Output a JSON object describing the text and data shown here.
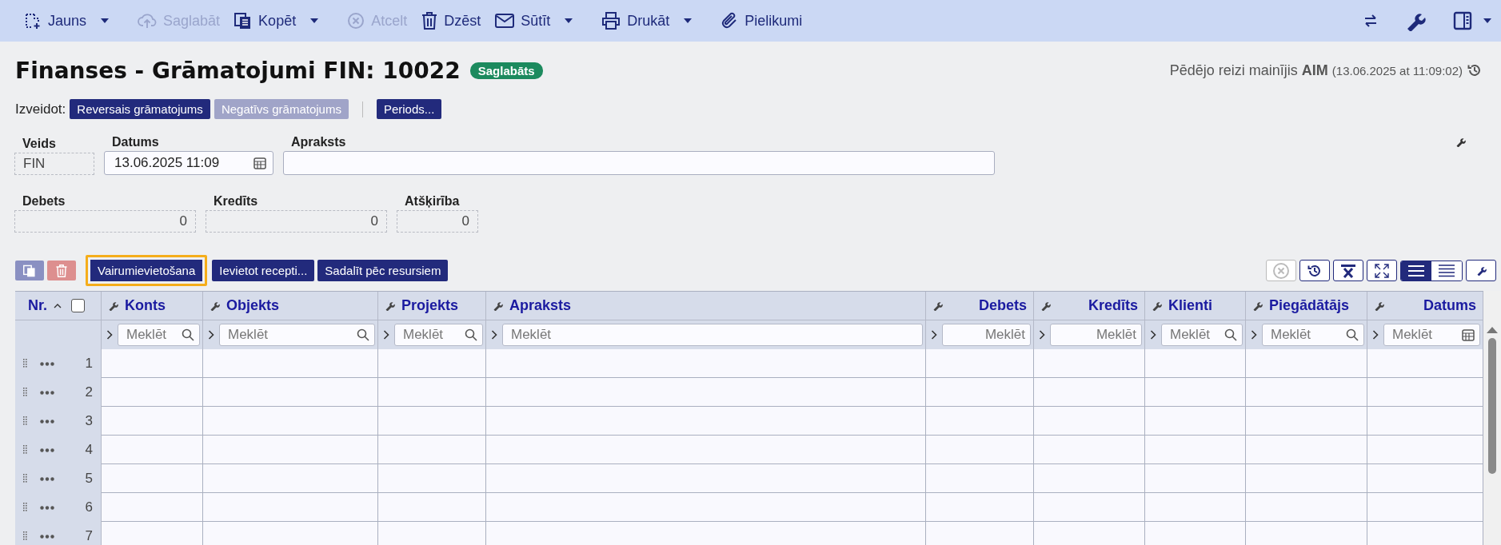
{
  "toolbar": {
    "items": [
      {
        "label": "Jauns",
        "disabled": false,
        "dropdown": true
      },
      {
        "label": "Saglabāt",
        "disabled": true,
        "dropdown": false
      },
      {
        "label": "Kopēt",
        "disabled": false,
        "dropdown": true
      },
      {
        "label": "Atcelt",
        "disabled": true,
        "dropdown": false
      },
      {
        "label": "Dzēst",
        "disabled": false,
        "dropdown": false
      },
      {
        "label": "Sūtīt",
        "disabled": false,
        "dropdown": true
      },
      {
        "label": "Drukāt",
        "disabled": false,
        "dropdown": true
      },
      {
        "label": "Pielikumi",
        "disabled": false,
        "dropdown": false
      }
    ]
  },
  "header": {
    "title": "Finanses - Grāmatojumi FIN: 10022",
    "status": "Saglabāts",
    "last_modified": "Pēdējo reizi mainījis **AIM**",
    "last_modified_time": "(13.06.2025 at 11:09:02)"
  },
  "create": {
    "label": "Izveidot:",
    "buttons": [
      {
        "label": "Reversais grāmatojums",
        "disabled": false
      },
      {
        "label": "Negatīvs grāmatojums",
        "disabled": true
      },
      {
        "label": "Periods...",
        "disabled": false
      }
    ]
  },
  "fields": [
    {
      "label": "Veids",
      "value": "FIN",
      "kind": "readonly"
    },
    {
      "label": "Datums",
      "value": "13.06.2025 11:09",
      "kind": "date"
    },
    {
      "label": "Apraksts",
      "kind": "text"
    }
  ],
  "totals": [
    {
      "label": "Debets",
      "value": "0"
    },
    {
      "label": "Kredīts",
      "value": "0"
    },
    {
      "label": "Atšķirība",
      "value": "0"
    }
  ],
  "table_toolbar": {
    "buttons": [
      {
        "label": "Vairumievietošana",
        "focused": true
      },
      {
        "label": "Ievietot recepti...",
        "focused": false
      },
      {
        "label": "Sadalīt pēc resursiem",
        "focused": false
      }
    ],
    "views": [
      {
        "selected": true
      },
      {
        "selected": false
      }
    ]
  },
  "table": {
    "nr_label": "Nr.",
    "select_all": false,
    "columns": [
      {
        "label": "Konts",
        "kind": "search",
        "placeholder": "Meklēt"
      },
      {
        "label": "Objekts",
        "kind": "search",
        "placeholder": "Meklēt"
      },
      {
        "label": "Projekts",
        "kind": "search",
        "placeholder": "Meklēt"
      },
      {
        "label": "Apraksts",
        "kind": "text",
        "placeholder": "Meklēt"
      },
      {
        "label": "Debets",
        "kind": "number",
        "placeholder": "Meklēt"
      },
      {
        "label": "Kredīts",
        "kind": "number",
        "placeholder": "Meklēt"
      },
      {
        "label": "Klienti",
        "kind": "search",
        "placeholder": "Meklēt"
      },
      {
        "label": "Piegādātājs",
        "kind": "search",
        "placeholder": "Meklēt"
      },
      {
        "label": "Datums",
        "kind": "date",
        "placeholder": "Meklēt"
      }
    ],
    "rows": [
      {
        "nr": "1"
      },
      {
        "nr": "2"
      },
      {
        "nr": "3"
      },
      {
        "nr": "4"
      },
      {
        "nr": "5"
      },
      {
        "nr": "6"
      },
      {
        "nr": "7"
      }
    ]
  }
}
